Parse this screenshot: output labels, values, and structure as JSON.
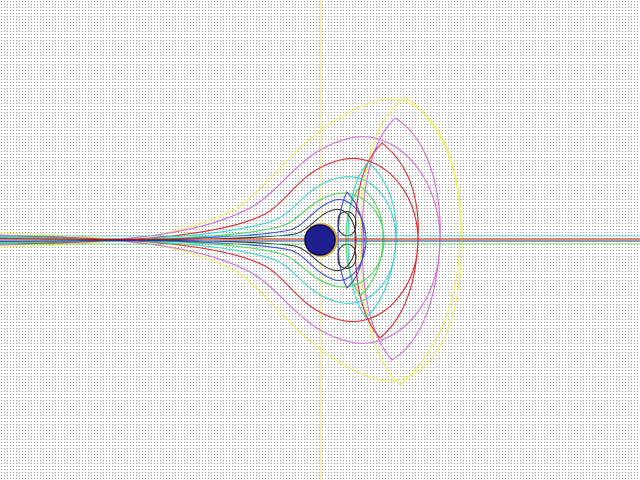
{
  "scene": {
    "kind": "field-line-plot",
    "background": "#ffffff",
    "stipple_color": "#9a9a9a",
    "axis_color": "#f2e98a",
    "center_body": {
      "fill": "#1f1f8f",
      "edge": "#0b0b55",
      "rim": "#d9a64a"
    },
    "curves": [
      {
        "name": "yellow",
        "color": "#f0ef6a"
      },
      {
        "name": "violet",
        "color": "#d66ad8"
      },
      {
        "name": "red",
        "color": "#e0282c"
      },
      {
        "name": "cyan",
        "color": "#3cd4d8"
      },
      {
        "name": "green",
        "color": "#4fd45a"
      },
      {
        "name": "blue",
        "color": "#3a4fd8"
      },
      {
        "name": "black",
        "color": "#2a2a2a"
      }
    ]
  }
}
